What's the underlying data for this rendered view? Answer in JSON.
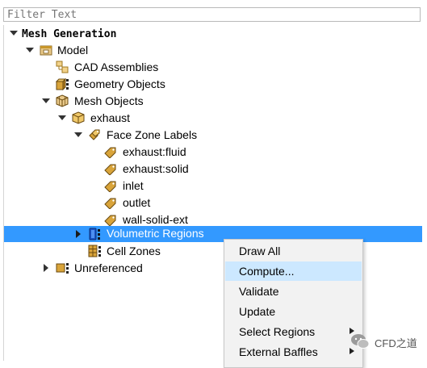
{
  "filter": {
    "placeholder": "Filter Text",
    "value": ""
  },
  "tree": {
    "root": "Mesh Generation",
    "model": "Model",
    "cad_assemblies": "CAD Assemblies",
    "geometry_objects": "Geometry Objects",
    "mesh_objects": "Mesh Objects",
    "exhaust": "exhaust",
    "face_zone_labels": "Face Zone Labels",
    "labels": [
      "exhaust:fluid",
      "exhaust:solid",
      "inlet",
      "outlet",
      "wall-solid-ext"
    ],
    "volumetric_regions": "Volumetric Regions",
    "cell_zones": "Cell Zones",
    "unreferenced": "Unreferenced"
  },
  "context_menu": {
    "items": [
      "Draw All",
      "Compute...",
      "Validate",
      "Update",
      "Select Regions",
      "External Baffles"
    ],
    "highlighted": "Compute..."
  },
  "watermark": "CFD之道",
  "colors": {
    "selection": "#3399ff",
    "menu_highlight": "#cce8ff",
    "menu_bg": "#f2f2f2",
    "icon_gold": "#c8962a"
  }
}
